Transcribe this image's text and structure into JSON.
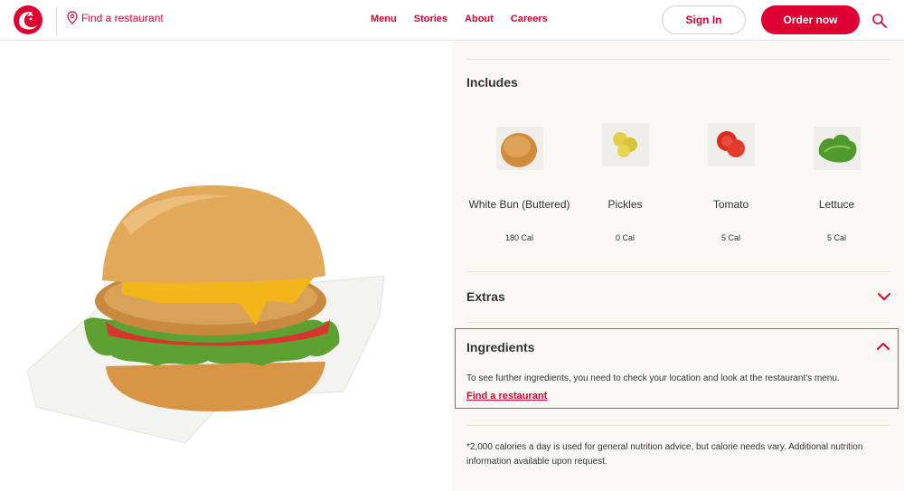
{
  "header": {
    "find_restaurant": "Find a restaurant",
    "nav": [
      "Menu",
      "Stories",
      "About",
      "Careers"
    ],
    "sign_in": "Sign In",
    "order_now": "Order now"
  },
  "product": {
    "image_alt": "Chicken sandwich with cheese, lettuce and tomato"
  },
  "includes": {
    "title": "Includes",
    "items": [
      {
        "name": "White Bun (Buttered)",
        "cal": "180 Cal",
        "icon": "bun-icon"
      },
      {
        "name": "Pickles",
        "cal": "0 Cal",
        "icon": "pickles-icon"
      },
      {
        "name": "Tomato",
        "cal": "5 Cal",
        "icon": "tomato-icon"
      },
      {
        "name": "Lettuce",
        "cal": "5 Cal",
        "icon": "lettuce-icon"
      }
    ]
  },
  "extras": {
    "title": "Extras"
  },
  "ingredients": {
    "title": "Ingredients",
    "text": "To see further ingredients, you need to check your location and look at the restaurant's menu.",
    "link": "Find a restaurant"
  },
  "footnote": "*2,000 calories a day is used for general nutrition advice, but calorie needs vary. Additional nutrition information available upon request.",
  "colors": {
    "brand": "#dd0031",
    "panel": "#f9f8f4",
    "highlight_border": "#e8413a"
  }
}
